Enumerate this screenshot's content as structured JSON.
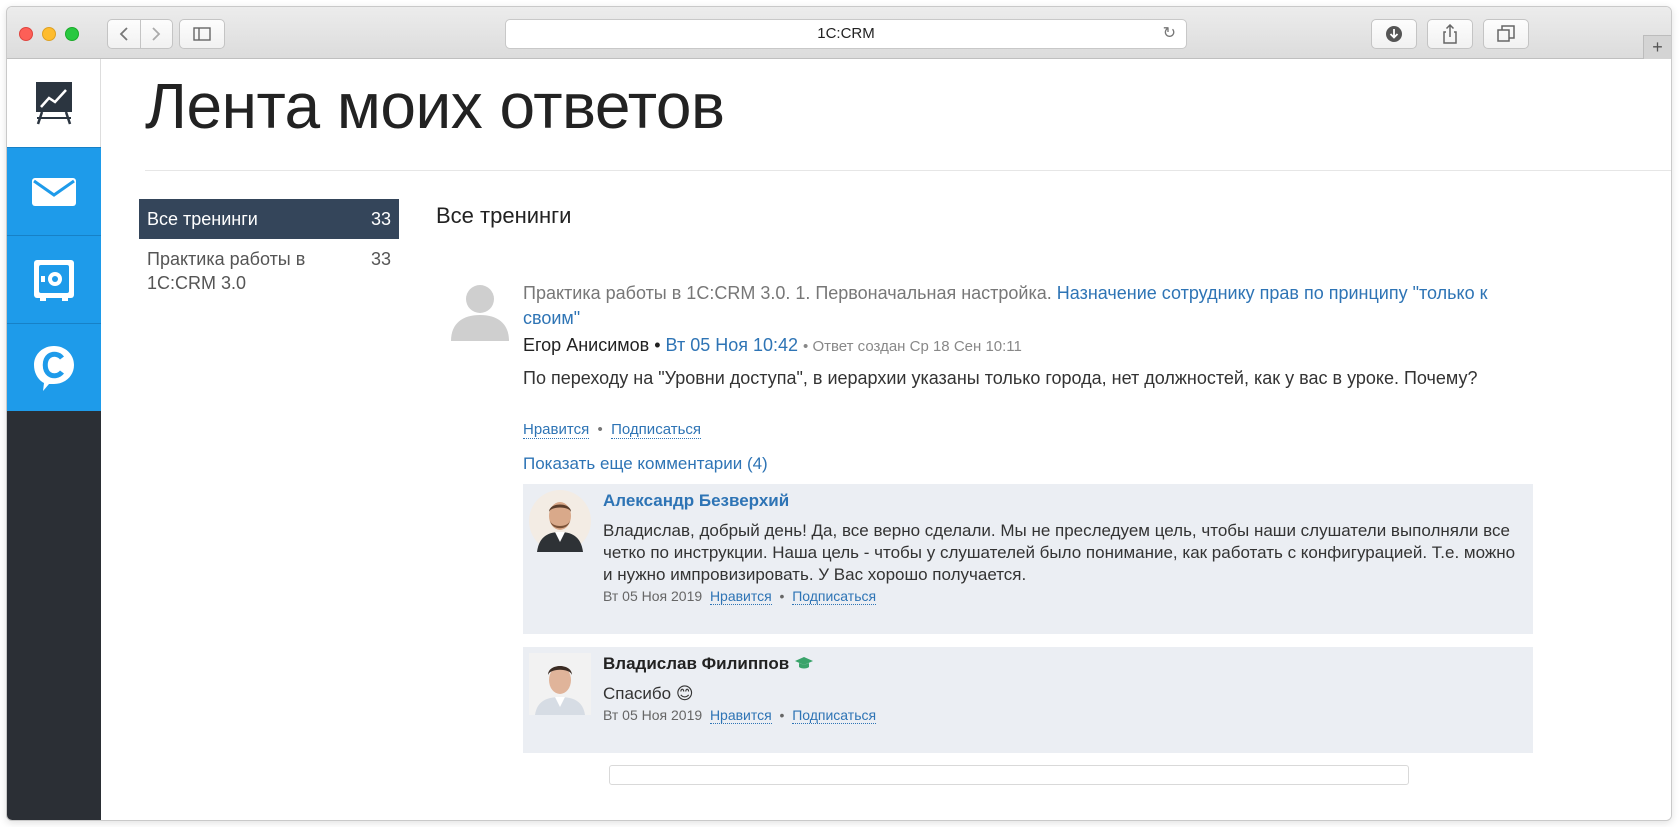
{
  "browser": {
    "address": "1C:CRM",
    "new_tab_label": "+"
  },
  "app_sidebar": {
    "items": [
      "dashboard-icon",
      "mail-icon",
      "safe-icon",
      "chat-icon"
    ],
    "accent_color": "#1e9bea",
    "dark_color": "#2b2f35"
  },
  "page": {
    "title": "Лента моих ответов"
  },
  "categories": [
    {
      "label": "Все тренинги",
      "count": "33",
      "active": true
    },
    {
      "label": "Практика работы в 1С:CRM 3.0",
      "count": "33",
      "active": false
    }
  ],
  "section_title": "Все тренинги",
  "post": {
    "crumb_prefix": "Практика работы в 1С:CRM 3.0. 1. Первоначальная настройка.",
    "crumb_link": "Назначение сотруднику прав по принципу \"только к своим\"",
    "author": "Егор Анисимов",
    "bullet": "•",
    "date": "Вт 05 Ноя 10:42",
    "created": "• Ответ создан Ср 18 Сен 10:11",
    "text": "По переходу на \"Уровни доступа\", в иерархии указаны только города, нет должностей, как у вас в уроке. Почему?",
    "like_label": "Нравится",
    "subscribe_label": "Подписаться",
    "more_comments": "Показать еще комментарии (4)"
  },
  "comments": [
    {
      "author": "Александр Безверхий",
      "text": "Владислав, добрый день! Да, все верно сделали. Мы не преследуем цель, чтобы наши слушатели выполняли все четко по инструкции. Наша цель - чтобы у слушателей было понимание, как работать с конфигурацией. Т.е. можно и нужно импровизировать. У Вас хорошо получается.",
      "date": "Вт 05 Ноя 2019",
      "like_label": "Нравится",
      "subscribe_label": "Подписаться"
    },
    {
      "author": "Владислав Филиппов",
      "text": "Спасибо",
      "emoji": "😊",
      "date": "Вт 05 Ноя 2019",
      "like_label": "Нравится",
      "subscribe_label": "Подписаться"
    }
  ]
}
